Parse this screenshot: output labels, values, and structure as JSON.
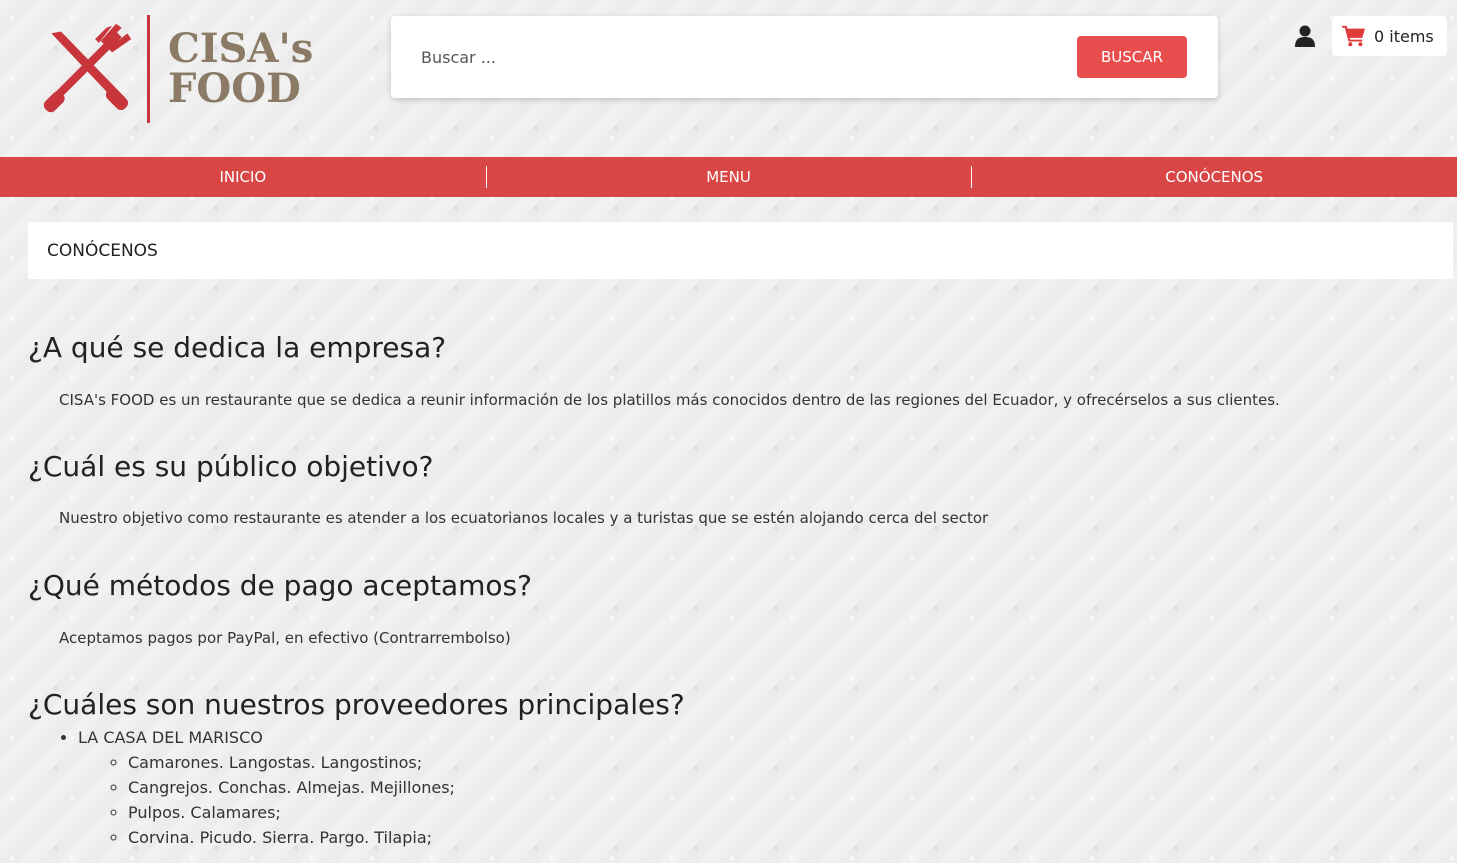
{
  "brand": {
    "line1": "CISA's",
    "line2": "FOOD",
    "accent": "#c8353a"
  },
  "search": {
    "placeholder": "Buscar ...",
    "button": "BUSCAR"
  },
  "cart": {
    "label": "0 items"
  },
  "icons": {
    "user": "user-icon",
    "cart": "cart-icon"
  },
  "nav": {
    "items": [
      {
        "label": "INICIO"
      },
      {
        "label": "MENU"
      },
      {
        "label": "CONÓCENOS"
      }
    ],
    "color": "#d94646"
  },
  "page": {
    "title": "CONÓCENOS"
  },
  "sections": [
    {
      "heading": "¿A qué se dedica la empresa?",
      "text": "CISA's FOOD es un restaurante que se dedica a reunir información de los platillos más conocidos dentro de las regiones del Ecuador, y ofrecérselos a sus clientes."
    },
    {
      "heading": "¿Cuál es su público objetivo?",
      "text": "Nuestro objetivo como restaurante es atender a los ecuatorianos locales y a turistas que se estén alojando cerca del sector"
    },
    {
      "heading": "¿Qué métodos de pago aceptamos?",
      "text": "Aceptamos pagos por PayPal, en efectivo (Contrarrembolso)"
    },
    {
      "heading": "¿Cuáles son nuestros proveedores principales?"
    }
  ],
  "providers": [
    {
      "name": "LA CASA DEL MARISCO",
      "items": [
        "Camarones. Langostas. Langostinos;",
        "Cangrejos. Conchas. Almejas. Mejillones;",
        "Pulpos. Calamares;",
        "Corvina. Picudo. Sierra. Pargo. Tilapia;"
      ]
    }
  ]
}
